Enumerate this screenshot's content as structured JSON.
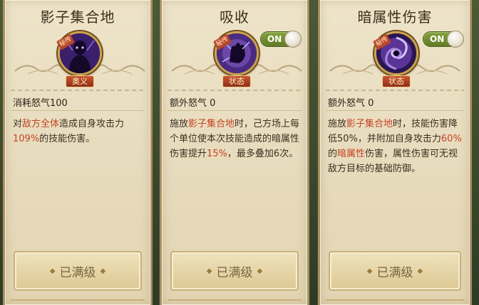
{
  "cards": [
    {
      "title": "影子集合地",
      "badge": "秘传",
      "tag": "奥义",
      "cost": "消耗怒气100",
      "desc": [
        {
          "t": "对",
          "h": false
        },
        {
          "t": "敌方全体",
          "h": true
        },
        {
          "t": "造成自身攻击力",
          "h": false
        },
        {
          "t": "109%",
          "h": true
        },
        {
          "t": "的技能伤害。",
          "h": false
        }
      ],
      "button": "已满级",
      "icon": "shadow-ninja-icon"
    },
    {
      "title": "吸收",
      "badge": "秘传",
      "toggle": "ON",
      "tag": "状态",
      "cost": "额外怒气 0",
      "desc": [
        {
          "t": "施放",
          "h": false
        },
        {
          "t": "影子集合地",
          "h": true
        },
        {
          "t": "时，己方场上每个单位使本次技能造成的暗属性伤害提升",
          "h": false
        },
        {
          "t": "15%",
          "h": true
        },
        {
          "t": "，最多叠加6次。",
          "h": false
        }
      ],
      "button": "已满级",
      "icon": "shadow-fist-icon"
    },
    {
      "title": "暗属性伤害",
      "badge": "秘传",
      "toggle": "ON",
      "tag": "状态",
      "cost": "额外怒气 0",
      "desc": [
        {
          "t": "施放",
          "h": false
        },
        {
          "t": "影子集合地",
          "h": true
        },
        {
          "t": "时，技能伤害降低50%，并附加自身攻击力",
          "h": false
        },
        {
          "t": "60%",
          "h": true
        },
        {
          "t": "的",
          "h": false
        },
        {
          "t": "暗属性",
          "h": true
        },
        {
          "t": "伤害，属性伤害可无视敌方目标的基础防御。",
          "h": false
        }
      ],
      "button": "已满级",
      "icon": "dark-vortex-icon"
    }
  ]
}
